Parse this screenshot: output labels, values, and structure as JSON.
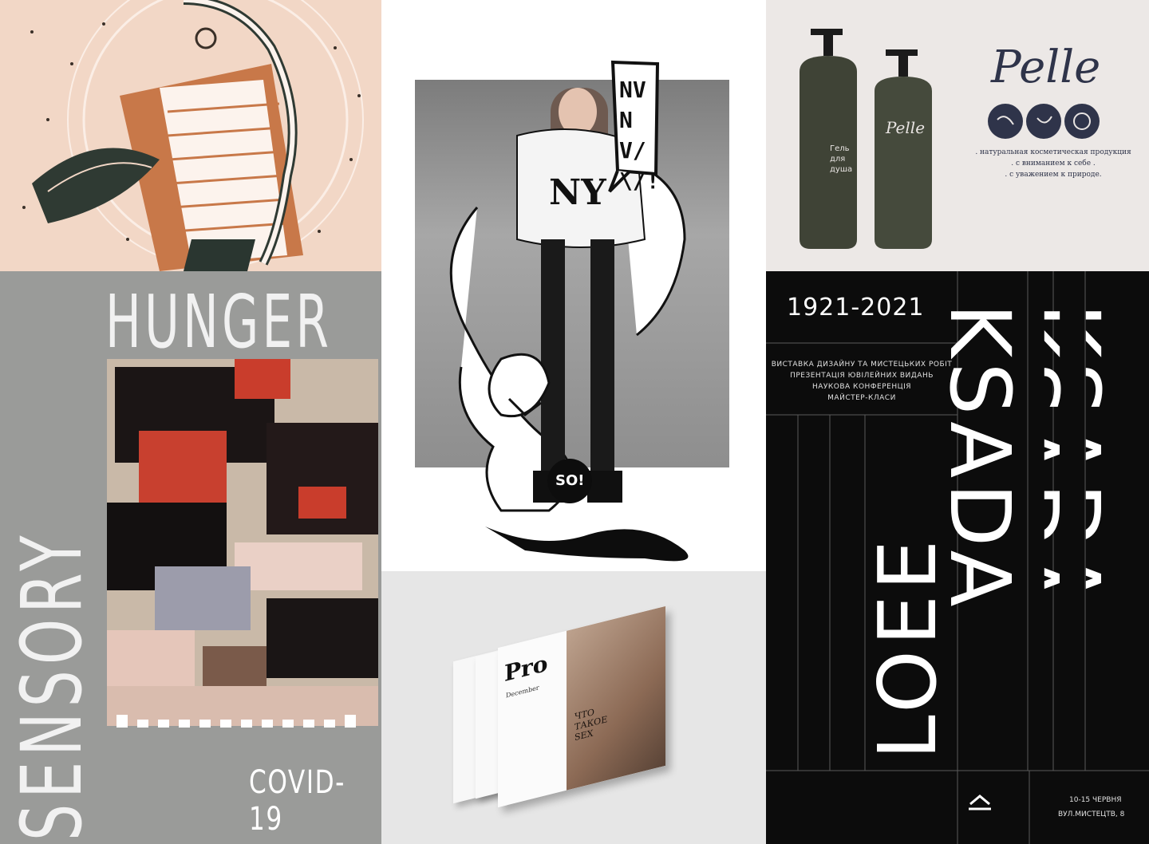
{
  "sensory": {
    "hunger": "HUNGER",
    "sensory": "SENSORY",
    "covid": "COVID-19"
  },
  "ny": {
    "speech": "NVNV/\\/!",
    "sweater": "NY",
    "badge": "SO!"
  },
  "magazine": {
    "brand": "Pro",
    "month": "December",
    "headline": "ЧТО ТАКОЕ SEX"
  },
  "pelle": {
    "logo": "Pelle",
    "bottle_label": "Гель для душа",
    "bottle_logo": "Pelle",
    "tagline_1": ". натуральная косметическая продукция .",
    "tagline_2": ". с вниманием к себе .",
    "tagline_3": ". с уважением к природе."
  },
  "ksada": {
    "years": "1921-2021",
    "events": [
      "ВИСТАВКА ДИЗАЙНУ ТА МИСТЕЦЬКИХ РОБІТ",
      "ПРЕЗЕНТАЦІЯ ЮВІЛЕЙНИХ ВИДАНЬ",
      "НАУКОВА КОНФЕРЕНЦІЯ",
      "МАЙСТЕР-КЛАСИ"
    ],
    "name": "KSADA",
    "name_reversed": "LOEE",
    "dates": "10-15 ЧЕРВНЯ",
    "address": "ВУЛ.МИСТЕЦТВ, 8"
  }
}
